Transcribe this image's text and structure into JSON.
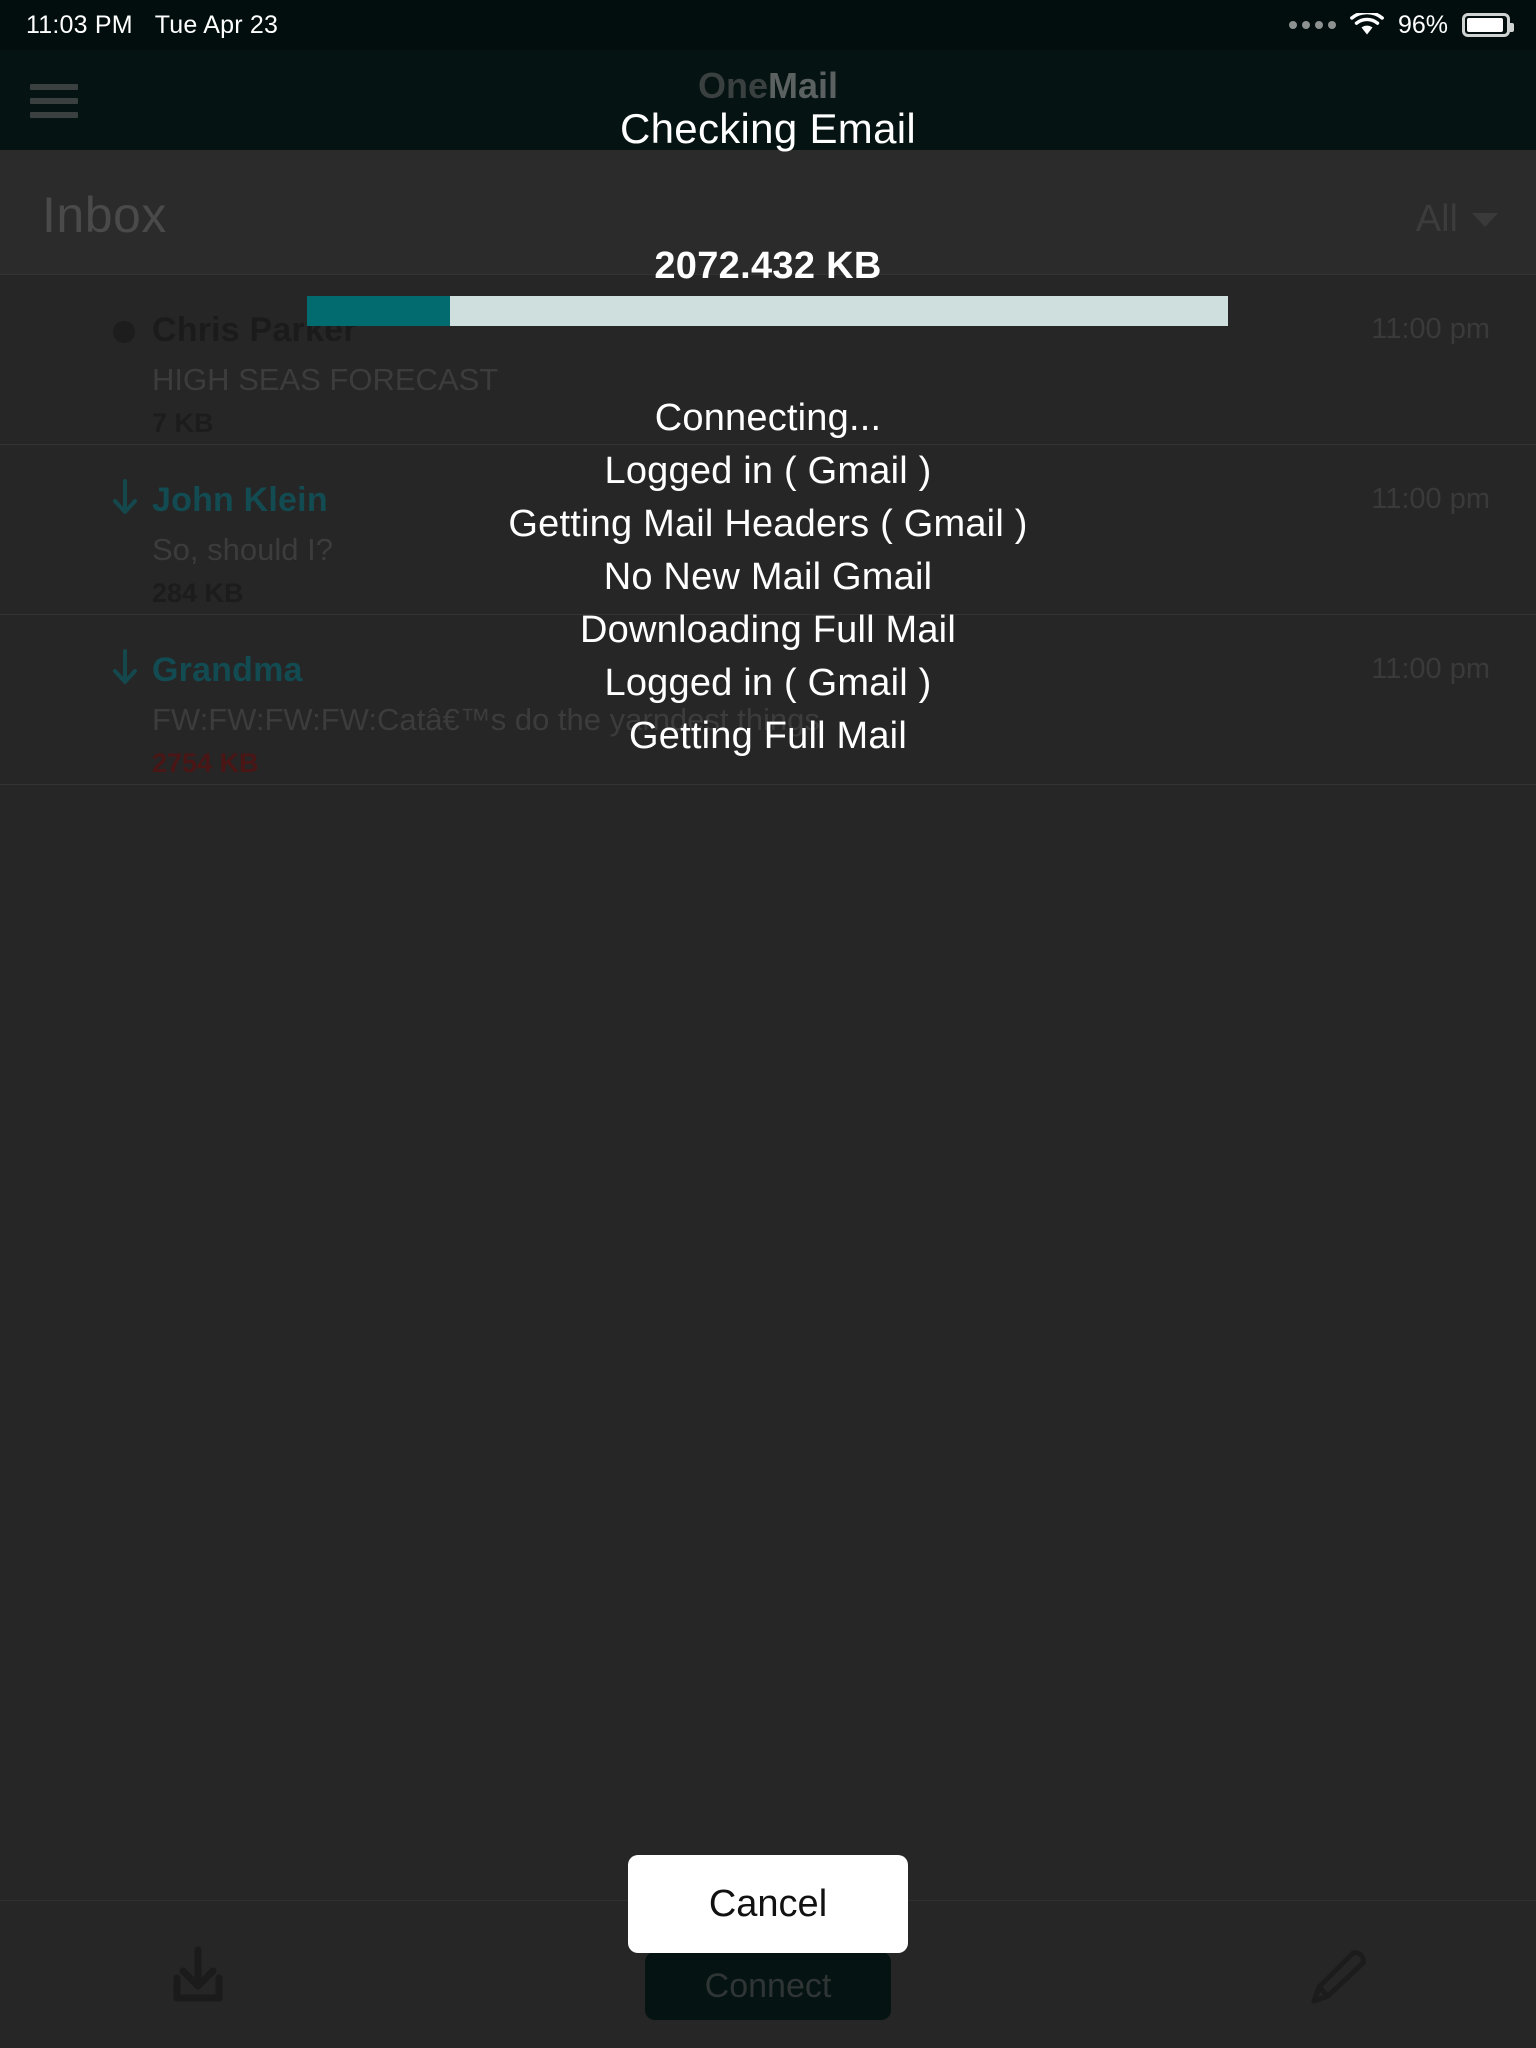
{
  "statusbar": {
    "time": "11:03 PM",
    "date": "Tue Apr 23",
    "battery_percent": "96%",
    "wifi_icon": "wifi-icon",
    "signal_icon": "signal-dots-icon",
    "battery_icon": "battery-icon"
  },
  "appbar": {
    "menu_icon": "hamburger-menu-icon",
    "brand_part1": "One",
    "brand_part2": "Mail"
  },
  "inboxbar": {
    "title": "Inbox",
    "filter_label": "All",
    "filter_caret_icon": "chevron-down-icon"
  },
  "mail": {
    "rows": [
      {
        "marker": "unread-dot",
        "name": "Chris Parker",
        "subject": "HIGH SEAS FORECAST",
        "size": "7 KB",
        "size_state": "normal",
        "time": "11:00 pm",
        "read_state": "unread"
      },
      {
        "marker": "download-arrow",
        "name": "John Klein",
        "subject": "So, should I?",
        "size": "284 KB",
        "size_state": "normal",
        "time": "11:00 pm",
        "read_state": "read"
      },
      {
        "marker": "download-arrow",
        "name": "Grandma",
        "subject": "FW:FW:FW:FW:Catâ€™s do the yarndest things",
        "size": "2754 KB",
        "size_state": "large",
        "time": "11:00 pm",
        "read_state": "read"
      }
    ]
  },
  "toolbar": {
    "receive_icon": "download-inbox-icon",
    "compose_icon": "pencil-compose-icon",
    "connect_label": "Connect"
  },
  "overlay": {
    "title": "Checking Email",
    "bytes": "2072.432 KB",
    "progress_percent": 15.5,
    "status_lines": [
      "Connecting...",
      "Logged in ( Gmail )",
      "Getting Mail Headers ( Gmail )",
      "No New Mail Gmail",
      "Downloading Full Mail",
      "Logged in ( Gmail )",
      "Getting Full Mail"
    ],
    "cancel_label": "Cancel"
  },
  "colors": {
    "accent_teal": "#016b6f",
    "progress_track": "#cedfdd",
    "appbar_bg": "#051312",
    "list_bg": "#262626",
    "size_large": "#4a1515"
  }
}
